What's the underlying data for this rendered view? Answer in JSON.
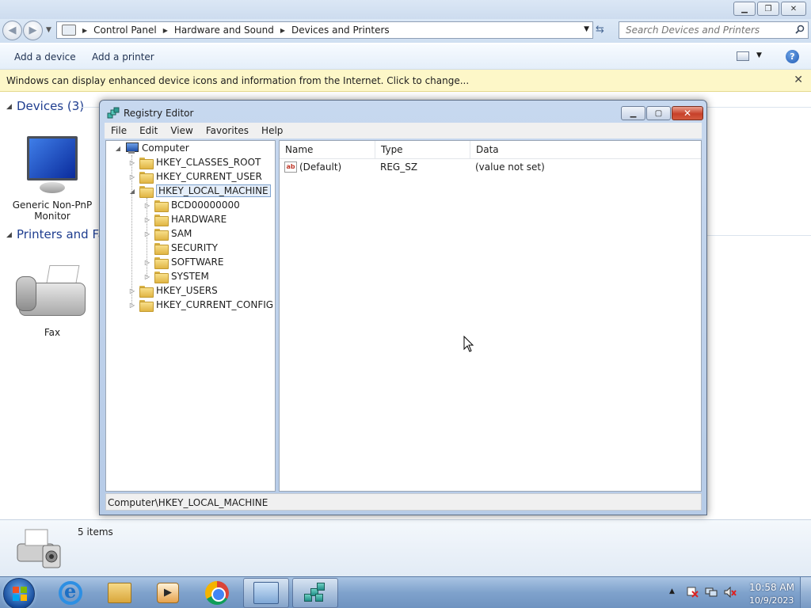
{
  "explorer": {
    "breadcrumb": [
      "Control Panel",
      "Hardware and Sound",
      "Devices and Printers"
    ],
    "search_placeholder": "Search Devices and Printers",
    "commands": {
      "add_device": "Add a device",
      "add_printer": "Add a printer"
    },
    "infobar_text": "Windows can display enhanced device icons and information from the Internet. Click to change...",
    "groups": {
      "devices": {
        "label": "Devices (3)",
        "items": [
          "Generic Non-PnP Monitor"
        ]
      },
      "printers": {
        "label": "Printers and Faxes",
        "items": [
          "Fax"
        ]
      }
    },
    "details_count": "5 items"
  },
  "regedit": {
    "title": "Registry Editor",
    "menu": [
      "File",
      "Edit",
      "View",
      "Favorites",
      "Help"
    ],
    "tree": {
      "root": "Computer",
      "hives": [
        "HKEY_CLASSES_ROOT",
        "HKEY_CURRENT_USER",
        "HKEY_LOCAL_MACHINE",
        "HKEY_USERS",
        "HKEY_CURRENT_CONFIG"
      ],
      "hklm_children": [
        "BCD00000000",
        "HARDWARE",
        "SAM",
        "SECURITY",
        "SOFTWARE",
        "SYSTEM"
      ],
      "selected": "HKEY_LOCAL_MACHINE"
    },
    "columns": [
      "Name",
      "Type",
      "Data"
    ],
    "values": [
      {
        "name": "(Default)",
        "type": "REG_SZ",
        "data": "(value not set)",
        "icon": "ab-string-icon"
      }
    ],
    "status": "Computer\\HKEY_LOCAL_MACHINE"
  },
  "taskbar": {
    "apps": [
      "internet-explorer",
      "windows-explorer",
      "media-player",
      "chrome",
      "control-panel",
      "registry-editor"
    ],
    "active_apps": [
      "control-panel",
      "registry-editor"
    ],
    "clock_time": "10:58 AM",
    "clock_date": "10/9/2023"
  }
}
